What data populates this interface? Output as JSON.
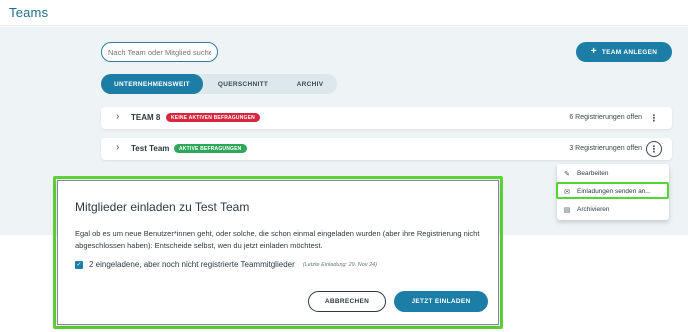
{
  "header": {
    "title": "Teams"
  },
  "toolbar": {
    "search_placeholder": "Nach Team oder Mitglied suche",
    "new_team_label": "TEAM ANLEGEN"
  },
  "tabs": [
    {
      "label": "UNTERNEHMENSWEIT",
      "active": true
    },
    {
      "label": "QUERSCHNITT",
      "active": false
    },
    {
      "label": "ARCHIV",
      "active": false
    }
  ],
  "teams": [
    {
      "name": "TEAM 8",
      "badge": "KEINE AKTIVEN BEFRAGUNGEN",
      "badge_color": "#d7263d",
      "registrations": "6 Registrierungen offen"
    },
    {
      "name": "Test Team",
      "badge": "AKTIVE BEFRAGUNGEN",
      "badge_color": "#2fa75a",
      "registrations": "3 Registrierungen offen"
    }
  ],
  "context_menu": {
    "items": [
      {
        "label": "Bearbeiten",
        "icon": "pencil-icon"
      },
      {
        "label": "Einladungen senden an...",
        "icon": "envelope-icon",
        "highlighted": true
      },
      {
        "label": "Archivieren",
        "icon": "archive-icon"
      }
    ]
  },
  "dialog": {
    "title": "Mitglieder einladen zu Test Team",
    "text": "Egal ob es um neue Benutzer*innen geht, oder solche, die schon einmal eingeladen wurden (aber ihre Registrierung nicht abgeschlossen haben): Entscheide selbst, wen du jetzt einladen möchtest.",
    "checkbox_label": "2 eingeladene, aber noch nicht registrierte Teammitglieder",
    "checkbox_checked": true,
    "checkbox_note": "(Letzte Einladung: 29. Nov 24)",
    "cancel_label": "ABBRECHEN",
    "invite_label": "JETZT EINLADEN"
  },
  "colors": {
    "accent": "#1c7ea6",
    "highlight": "#5ed437",
    "background": "#eef3f5"
  }
}
